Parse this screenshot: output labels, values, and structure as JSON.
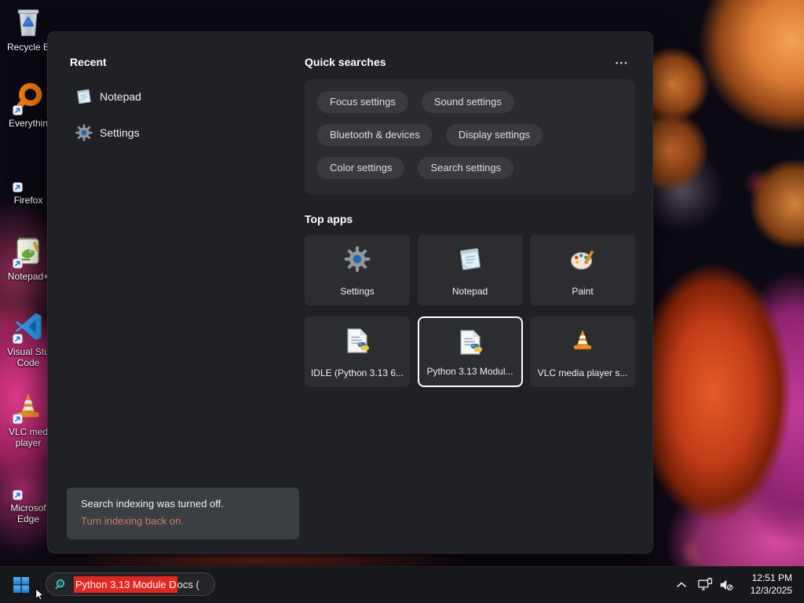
{
  "desktop_icons": [
    {
      "icon": "recycle-bin-icon",
      "label": "Recycle B",
      "label2": ""
    },
    {
      "icon": "everything-search-icon",
      "label": "Everythin",
      "label2": ""
    },
    {
      "icon": "firefox-icon",
      "label": "Firefox",
      "label2": ""
    },
    {
      "icon": "notepad-plus-plus-icon",
      "label": "Notepad+",
      "label2": ""
    },
    {
      "icon": "visual-studio-code-icon",
      "label": "Visual Stu",
      "label2": "Code"
    },
    {
      "icon": "vlc-cone-icon",
      "label": "VLC med",
      "label2": "player"
    },
    {
      "icon": "microsoft-edge-icon",
      "label": "Microsof",
      "label2": "Edge"
    }
  ],
  "panel": {
    "recent": {
      "title": "Recent",
      "items": [
        {
          "icon": "notepad-icon",
          "label": "Notepad"
        },
        {
          "icon": "settings-gear-icon",
          "label": "Settings"
        }
      ]
    },
    "quick_searches": {
      "title": "Quick searches",
      "more_label": "•••",
      "pills": [
        "Focus settings",
        "Sound settings",
        "Bluetooth & devices",
        "Display settings",
        "Color settings",
        "Search settings"
      ]
    },
    "top_apps": {
      "title": "Top apps",
      "tiles": [
        {
          "icon": "settings-gear-icon",
          "label": "Settings",
          "selected": false
        },
        {
          "icon": "notepad-icon",
          "label": "Notepad",
          "selected": false
        },
        {
          "icon": "paint-icon",
          "label": "Paint",
          "selected": false
        },
        {
          "icon": "python-file-icon",
          "label": "IDLE (Python 3.13 6...",
          "selected": false
        },
        {
          "icon": "python-file-icon",
          "label": "Python 3.13 Modul...",
          "selected": true
        },
        {
          "icon": "vlc-cone-icon",
          "label": "VLC media player s...",
          "selected": false
        }
      ]
    },
    "notice": {
      "message": "Search indexing was turned off.",
      "action": "Turn indexing back on."
    }
  },
  "taskbar": {
    "search_box": {
      "value": "Python 3.13 Module Docs (",
      "selected_text": "Python 3.13 Module D",
      "unselected_text": "ocs ("
    },
    "tray": {
      "time": "12:51 PM",
      "date": "12/3/2025"
    }
  },
  "colors": {
    "selection_red": "#e5261f",
    "notice_link": "#cd7b6d",
    "accent_blue": "#2f9bf2",
    "tile_selection_border": "#ffffff"
  }
}
